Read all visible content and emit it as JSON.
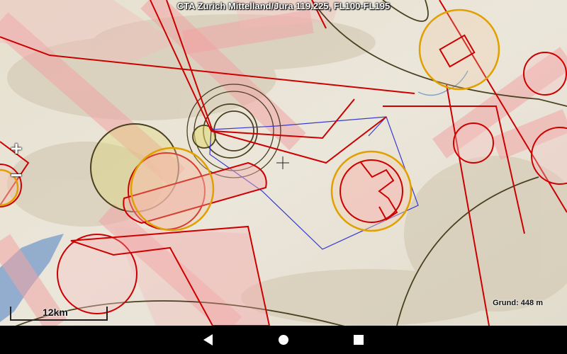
{
  "map": {
    "title": "CTA Zurich Mittelland/Jura 119.225, FL100-FL195",
    "scale_label": "12km",
    "ground_label": "Grund: 448 m",
    "zoom_in_label": "+",
    "zoom_out_label": "−"
  },
  "navbar": {
    "buttons": [
      "back",
      "home",
      "recents"
    ]
  },
  "colors": {
    "airspace_red": "#cc0000",
    "tma_fill": "#f2aaaa",
    "ctr_fill": "#f7c9c9",
    "olive": "#4a4020",
    "orange": "#e0a000",
    "route_blue": "#3a3ad0",
    "water": "#8aa6cc"
  }
}
